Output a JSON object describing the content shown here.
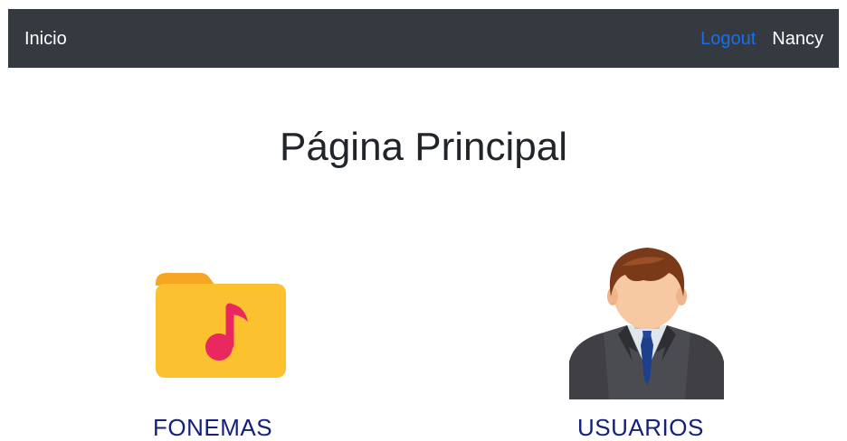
{
  "navbar": {
    "brand": "Inicio",
    "logout_label": "Logout",
    "username": "Nancy"
  },
  "main": {
    "title": "Página Principal",
    "cards": [
      {
        "label": "FONEMAS",
        "icon": "music-folder-icon"
      },
      {
        "label": "USUARIOS",
        "icon": "user-avatar-icon"
      }
    ]
  },
  "colors": {
    "navbar_bg": "#343a40",
    "logout_link": "#1a6fe8",
    "card_label": "#14207a",
    "folder": "#fcc12f",
    "note": "#e8285f"
  }
}
